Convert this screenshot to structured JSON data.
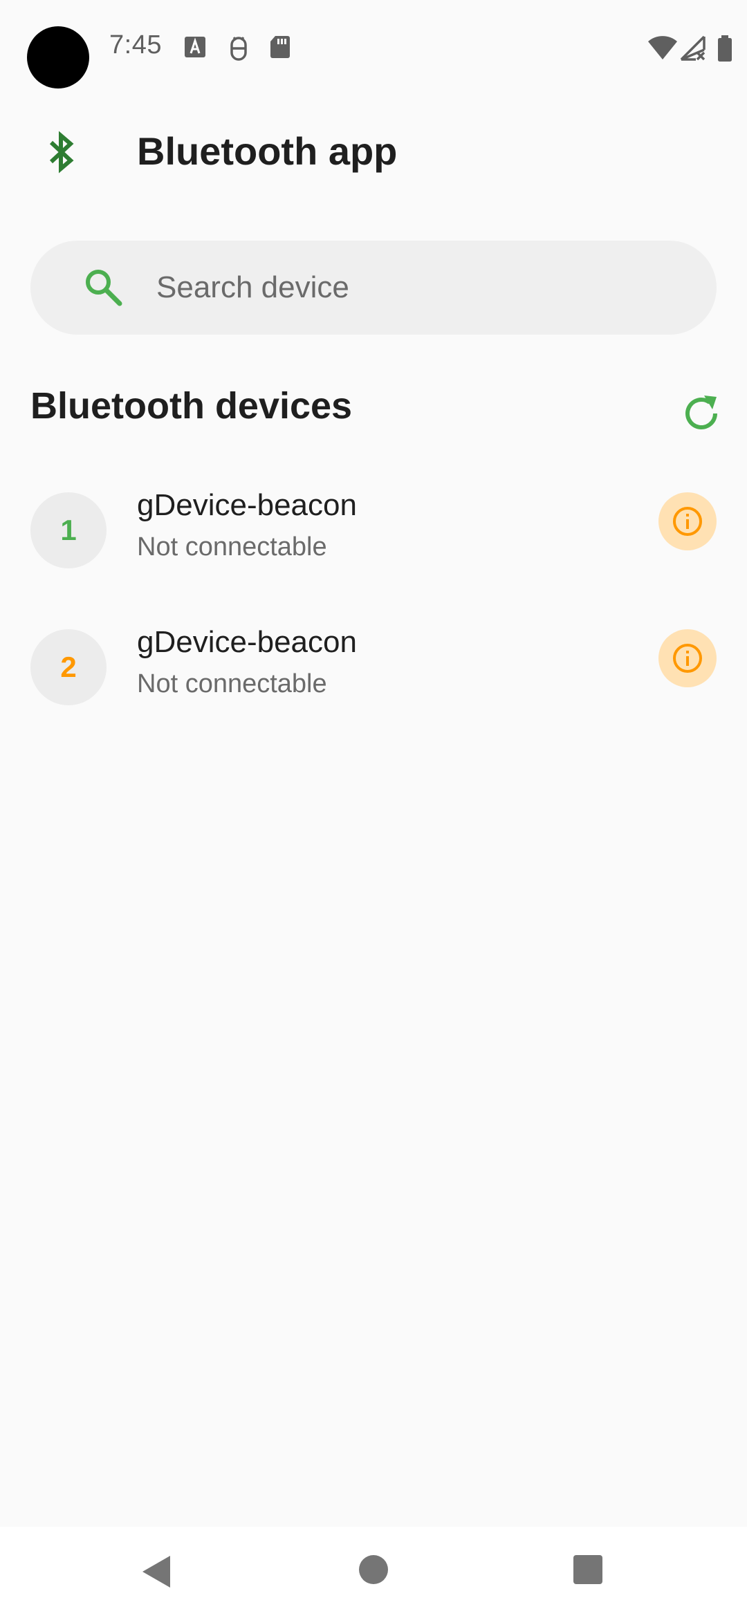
{
  "status_bar": {
    "time": "7:45",
    "icons": [
      "text-a-icon",
      "android-debug-icon",
      "sd-card-icon",
      "wifi-icon",
      "signal-no-service-icon",
      "battery-icon"
    ]
  },
  "app_bar": {
    "icon": "bluetooth-icon",
    "title": "Bluetooth app"
  },
  "search": {
    "icon": "search-icon",
    "placeholder": "Search device"
  },
  "devices_section": {
    "title": "Bluetooth devices",
    "refresh_icon": "refresh-icon",
    "items": [
      {
        "index": "1",
        "name": "gDevice-beacon",
        "status": "Not connectable",
        "index_color": "#4caf50"
      },
      {
        "index": "2",
        "name": "gDevice-beacon",
        "status": "Not connectable",
        "index_color": "#ff9800"
      }
    ]
  },
  "colors": {
    "accent_green": "#4caf50",
    "bluetooth_green": "#2e7d32",
    "info_orange": "#ff9800",
    "info_bg": "#ffe1b3"
  },
  "nav_bar": {
    "buttons": [
      "back-icon",
      "home-icon",
      "recents-icon"
    ]
  }
}
